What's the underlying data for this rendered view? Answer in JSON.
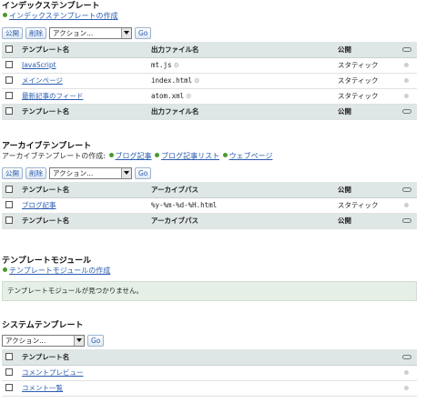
{
  "index": {
    "title": "インデックステンプレート",
    "create_link": "インデックステンプレートの作成",
    "publish_btn": "公開",
    "delete_btn": "削除",
    "action_select": "アクション...",
    "go_btn": "Go",
    "columns": {
      "name": "テンプレート名",
      "output": "出力ファイル名",
      "publish": "公開"
    },
    "rows": [
      {
        "name": "JavaScript",
        "output": "mt.js",
        "publish": "スタティック"
      },
      {
        "name": "メインページ",
        "output": "index.html",
        "publish": "スタティック"
      },
      {
        "name": "最新記事のフィード",
        "output": "atom.xml",
        "publish": "スタティック"
      }
    ]
  },
  "archive": {
    "title": "アーカイブテンプレート",
    "create_label": "アーカイブテンプレートの作成:",
    "create_links": [
      "ブログ記事",
      "ブログ記事リスト",
      "ウェブページ"
    ],
    "publish_btn": "公開",
    "delete_btn": "削除",
    "action_select": "アクション...",
    "go_btn": "Go",
    "columns": {
      "name": "テンプレート名",
      "path": "アーカイブパス",
      "publish": "公開"
    },
    "rows": [
      {
        "name": "ブログ記事",
        "path": "%y-%m-%d-%H.html",
        "publish": "スタティック"
      }
    ]
  },
  "modules": {
    "title": "テンプレートモジュール",
    "create_link": "テンプレートモジュールの作成",
    "empty_message": "テンプレートモジュールが見つかりません。"
  },
  "system": {
    "title": "システムテンプレート",
    "action_select": "アクション...",
    "go_btn": "Go",
    "columns": {
      "name": "テンプレート名"
    },
    "rows": [
      {
        "name": "コメントプレビュー"
      },
      {
        "name": "コメント一覧"
      }
    ]
  }
}
